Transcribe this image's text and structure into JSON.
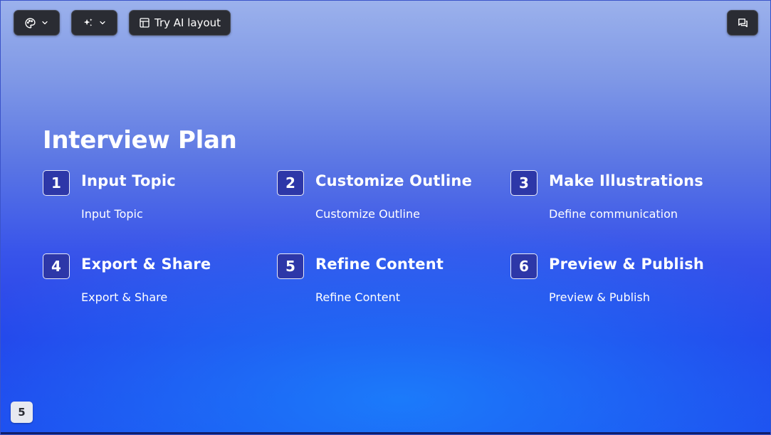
{
  "toolbar": {
    "theme_icon": "palette-icon",
    "magic_icon": "sparkle-icon",
    "layout_icon": "layout-icon",
    "layout_label": "Try AI layout",
    "chat_icon": "chat-icon"
  },
  "slide": {
    "title": "Interview Plan",
    "steps": [
      {
        "num": "1",
        "title": "Input Topic",
        "desc": "Input Topic"
      },
      {
        "num": "2",
        "title": "Customize Outline",
        "desc": "Customize Outline"
      },
      {
        "num": "3",
        "title": "Make Illustrations",
        "desc": "Define communication"
      },
      {
        "num": "4",
        "title": "Export & Share",
        "desc": "Export & Share"
      },
      {
        "num": "5",
        "title": "Refine Content",
        "desc": "Refine Content"
      },
      {
        "num": "6",
        "title": "Preview & Publish",
        "desc": "Preview & Publish"
      }
    ]
  },
  "page_number": "5",
  "colors": {
    "accent": "#1f48ee",
    "toolbar_bg": "#2a2c33",
    "badge_bg": "#2d37a8"
  }
}
